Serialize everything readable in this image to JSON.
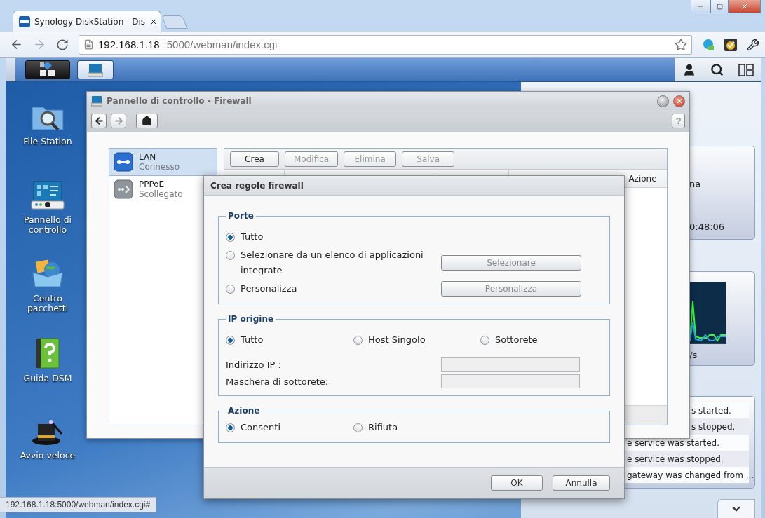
{
  "browser": {
    "tab_title": "Synology DiskStation - Dis",
    "url_host": "192.168.1.18",
    "url_path": ":5000/webman/index.cgi",
    "status_url": "192.168.1.18:5000/webman/index.cgi#"
  },
  "desktop_icons": [
    {
      "label": "File Station",
      "kind": "files"
    },
    {
      "label": "Pannello di controllo",
      "kind": "panel"
    },
    {
      "label": "Centro pacchetti",
      "kind": "package"
    },
    {
      "label": "Guida DSM",
      "kind": "help"
    },
    {
      "label": "Avvio veloce",
      "kind": "wizard"
    }
  ],
  "widgets": {
    "system_text": "na",
    "uptime": "0:48:06",
    "network_text": "/s",
    "log": [
      "s started.",
      "s stopped.",
      "e service was started.",
      "e service was stopped.",
      "gateway was changed from ..."
    ]
  },
  "control_panel": {
    "title": "Pannello di controllo - Firewall",
    "help_label": "?",
    "interfaces": [
      {
        "name": "LAN",
        "status": "Connesso",
        "selected": true,
        "kind": "connected"
      },
      {
        "name": "PPPoE",
        "status": "Scollegato",
        "selected": false,
        "kind": "disconnected"
      }
    ],
    "toolbar": [
      {
        "label": "Crea",
        "disabled": false
      },
      {
        "label": "Modifica",
        "disabled": true
      },
      {
        "label": "Elimina",
        "disabled": true
      },
      {
        "label": "Salva",
        "disabled": true
      }
    ],
    "last_column": "Azione"
  },
  "dialog": {
    "title": "Crea regole firewall",
    "ports": {
      "legend": "Porte",
      "options": [
        {
          "label": "Tutto",
          "selected": true
        },
        {
          "label": "Selezionare da un elenco di applicazioni integrate",
          "selected": false
        },
        {
          "label": "Personalizza",
          "selected": false
        }
      ],
      "buttons": [
        {
          "label": "Selezionare",
          "disabled": true
        },
        {
          "label": "Personalizza",
          "disabled": true
        }
      ]
    },
    "source_ip": {
      "legend": "IP origine",
      "options": [
        {
          "label": "Tutto",
          "selected": true
        },
        {
          "label": "Host Singolo",
          "selected": false
        },
        {
          "label": "Sottorete",
          "selected": false
        }
      ],
      "fields": [
        {
          "label": "Indirizzo IP :",
          "disabled": true
        },
        {
          "label": "Maschera di sottorete:",
          "disabled": true
        }
      ]
    },
    "action": {
      "legend": "Azione",
      "options": [
        {
          "label": "Consenti",
          "selected": true
        },
        {
          "label": "Rifiuta",
          "selected": false
        }
      ]
    },
    "buttons": [
      "OK",
      "Annulla"
    ]
  }
}
